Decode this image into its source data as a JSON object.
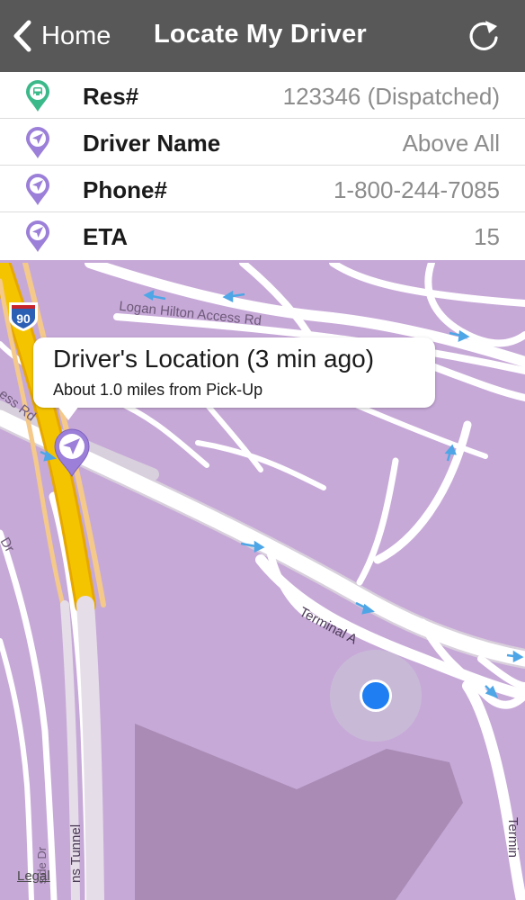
{
  "navbar": {
    "back_label": "Home",
    "title": "Locate My Driver",
    "refresh_icon": "refresh-icon",
    "background": "#585858"
  },
  "info_rows": [
    {
      "label": "Res#",
      "value": "123346 (Dispatched)",
      "icon": "car-pin-icon",
      "icon_color": "#3cb98a"
    },
    {
      "label": "Driver Name",
      "value": "Above All",
      "icon": "navigation-pin-icon",
      "icon_color": "#9b7fd8"
    },
    {
      "label": "Phone#",
      "value": "1-800-244-7085",
      "icon": "navigation-pin-icon",
      "icon_color": "#9b7fd8"
    },
    {
      "label": "ETA",
      "value": "15",
      "icon": "navigation-pin-icon",
      "icon_color": "#9b7fd8"
    }
  ],
  "map": {
    "callout_title": "Driver's Location (3 min ago)",
    "callout_subtitle": "About 1.0 miles from Pick-Up",
    "highway_shield": "90",
    "road_labels": {
      "logan": "Logan Hilton Access Rd",
      "terminal_a": "Terminal A",
      "ess_rd": "ess Rd",
      "dr_left": "Dr",
      "tunnel": "ns Tunnel",
      "side_dr": "side Dr",
      "termin": "Termin"
    },
    "legal": "Legal",
    "map_color": "#c7a9d8",
    "road_color": "#ffffff",
    "highway_color": "#f5c400",
    "user_dot_color": "#1e7ef2"
  }
}
